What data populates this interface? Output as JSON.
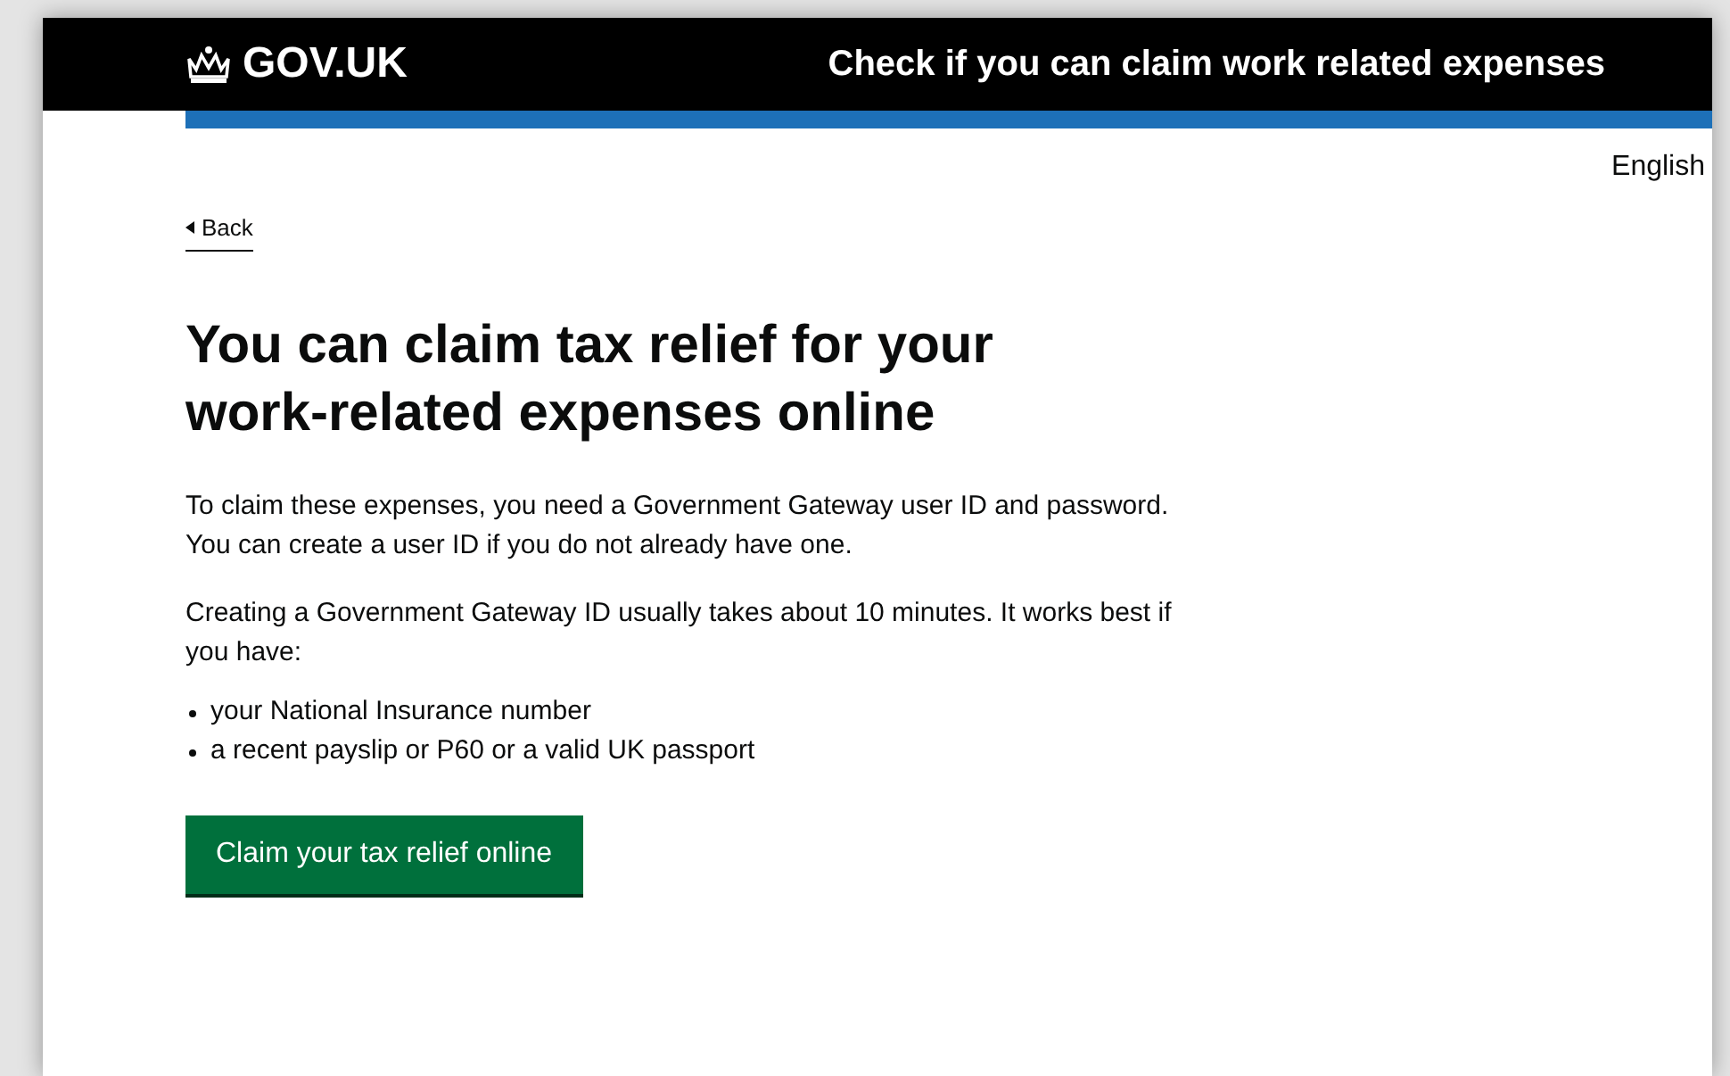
{
  "header": {
    "logo": "GOV.UK",
    "service_name": "Check if you can claim work related expenses"
  },
  "language": "English",
  "back_link": "Back",
  "heading": "You can claim tax relief for your work-related expenses online",
  "paragraphs": [
    "To claim these expenses, you need a Government Gateway user ID and password. You can create a user ID if you do not already have one.",
    "Creating a Government Gateway ID usually takes about 10 minutes. It works best if you have:"
  ],
  "list": [
    "your National Insurance number",
    "a recent payslip or P60 or a valid UK passport"
  ],
  "button": "Claim your tax relief online"
}
